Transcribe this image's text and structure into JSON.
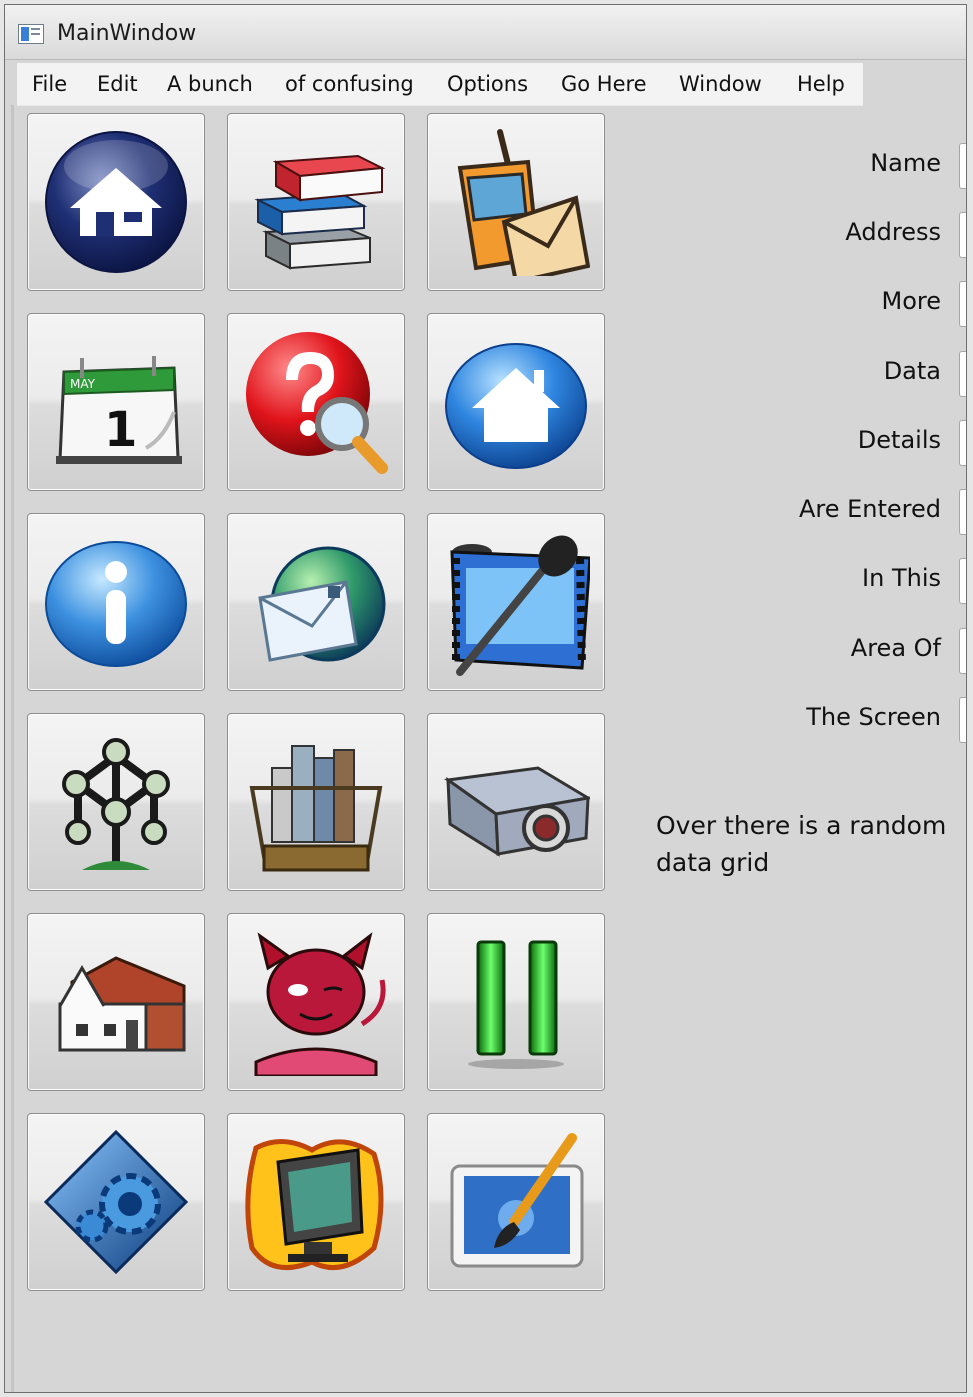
{
  "window": {
    "title": "MainWindow"
  },
  "menu": {
    "items": [
      "File",
      "Edit",
      "A bunch",
      "of confusing",
      "Options",
      "Go Here",
      "Window",
      "Help"
    ]
  },
  "icons": [
    "home-icon",
    "books-icon",
    "phone-mail-icon",
    "calendar-icon",
    "help-search-icon",
    "home-blue-icon",
    "info-icon",
    "email-globe-icon",
    "film-microphone-icon",
    "atomium-icon",
    "city-briefcase-icon",
    "projector-icon",
    "house-icon",
    "devil-icon",
    "pause-icon",
    "gear-diamond-icon",
    "computer-fire-icon",
    "paint-brush-icon"
  ],
  "form": {
    "labels": [
      "Name",
      "Address",
      "More",
      "Data",
      "Details",
      "Are Entered",
      "In This",
      "Area Of",
      "The Screen"
    ]
  },
  "note": "Over there is a random data grid",
  "calendar": {
    "month": "MAY",
    "day": "1"
  }
}
